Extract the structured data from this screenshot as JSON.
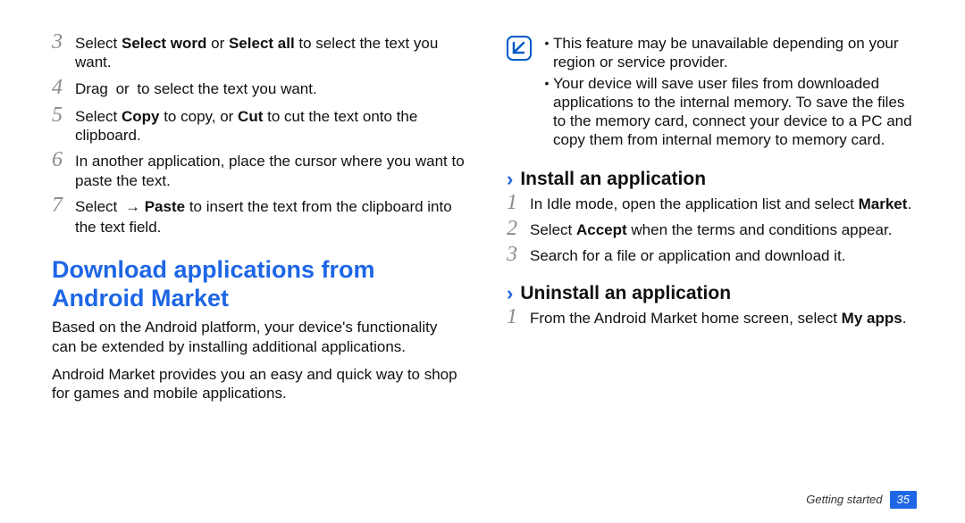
{
  "left": {
    "steps": [
      {
        "num": "3",
        "parts": [
          {
            "t": "Select "
          },
          {
            "t": "Select word",
            "b": true
          },
          {
            "t": " or "
          },
          {
            "t": "Select all",
            "b": true
          },
          {
            "t": " to select the text you want."
          }
        ]
      },
      {
        "num": "4",
        "parts": [
          {
            "t": "Drag "
          },
          {
            "icon": "handle"
          },
          {
            "t": " or "
          },
          {
            "icon": "handle"
          },
          {
            "t": " to select the text you want."
          }
        ]
      },
      {
        "num": "5",
        "parts": [
          {
            "t": "Select "
          },
          {
            "t": "Copy",
            "b": true
          },
          {
            "t": " to copy, or "
          },
          {
            "t": "Cut",
            "b": true
          },
          {
            "t": " to cut the text onto the clipboard."
          }
        ]
      },
      {
        "num": "6",
        "parts": [
          {
            "t": "In another application, place the cursor where you want to paste the text."
          }
        ]
      },
      {
        "num": "7",
        "parts": [
          {
            "t": "Select "
          },
          {
            "icon": "menu"
          },
          {
            "t": " → "
          },
          {
            "t": "Paste",
            "b": true
          },
          {
            "t": " to insert the text from the clipboard into the text field."
          }
        ]
      }
    ],
    "heading": "Download applications from Android Market",
    "p1": "Based on the Android platform, your device's functionality can be extended by installing additional applications.",
    "p2": "Android Market provides you an easy and quick way to shop for games and mobile applications."
  },
  "right": {
    "note": [
      "This feature may be unavailable depending on your region or service provider.",
      "Your device will save user files from downloaded applications to the internal memory. To save the files to the memory card, connect your device to a PC and copy them from internal memory to memory card."
    ],
    "install_head": "Install an application",
    "install_steps": [
      {
        "num": "1",
        "parts": [
          {
            "t": "In Idle mode, open the application list and select "
          },
          {
            "t": "Market",
            "b": true
          },
          {
            "t": "."
          }
        ]
      },
      {
        "num": "2",
        "parts": [
          {
            "t": "Select "
          },
          {
            "t": "Accept",
            "b": true
          },
          {
            "t": " when the terms and conditions appear."
          }
        ]
      },
      {
        "num": "3",
        "parts": [
          {
            "t": "Search for a file or application and download it."
          }
        ]
      }
    ],
    "uninstall_head": "Uninstall an application",
    "uninstall_steps": [
      {
        "num": "1",
        "parts": [
          {
            "t": "From the Android Market home screen, select "
          },
          {
            "t": "My apps",
            "b": true
          },
          {
            "t": "."
          }
        ]
      }
    ]
  },
  "footer": {
    "label": "Getting started",
    "page": "35"
  }
}
